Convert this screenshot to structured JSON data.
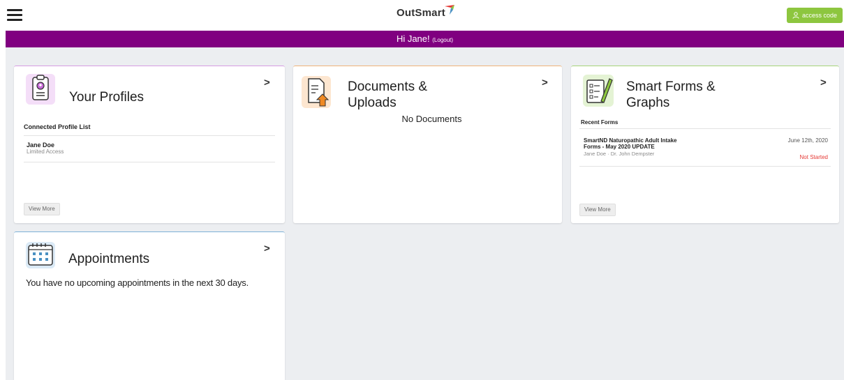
{
  "header": {
    "logo_text": "OutSmart",
    "access_label": "access code"
  },
  "greeting": {
    "text": "Hi Jane!",
    "logout": "(Logout)"
  },
  "colors": {
    "brand_purple": "#800080",
    "access_green": "#8dc63f",
    "not_started_red": "#e53935",
    "profiles_accent": "#c76ad9",
    "documents_accent": "#f0a35a",
    "forms_accent": "#8dc63f",
    "appointments_accent": "#4a90c2"
  },
  "profiles": {
    "title": "Your Profiles",
    "section_label": "Connected Profile List",
    "items": [
      {
        "name": "Jane Doe",
        "access": "Limited Access"
      }
    ],
    "view_more": "View More"
  },
  "documents": {
    "title_line1": "Documents &",
    "title_line2": "Uploads",
    "empty_text": "No Documents"
  },
  "forms": {
    "title_line1": "Smart Forms &",
    "title_line2": "Graphs",
    "section_label": "Recent Forms",
    "items": [
      {
        "name_line1": "SmartND Naturopathic Adult Intake",
        "name_line2": "Forms - May 2020 UPDATE",
        "people": "Jane Doe · Dr. John Dempster",
        "date": "June 12th, 2020",
        "status": "Not Started"
      }
    ],
    "view_more": "View More"
  },
  "appointments": {
    "title": "Appointments",
    "empty_text": "You have no upcoming appointments in the next 30 days."
  },
  "icons": {
    "menu": "hamburger-icon",
    "chevron": "chevron-right-icon",
    "chevron_glyph": ">",
    "user": "user-icon",
    "profile": "clipboard-profile-icon",
    "document": "document-upload-icon",
    "form": "form-pencil-icon",
    "calendar": "calendar-icon"
  }
}
